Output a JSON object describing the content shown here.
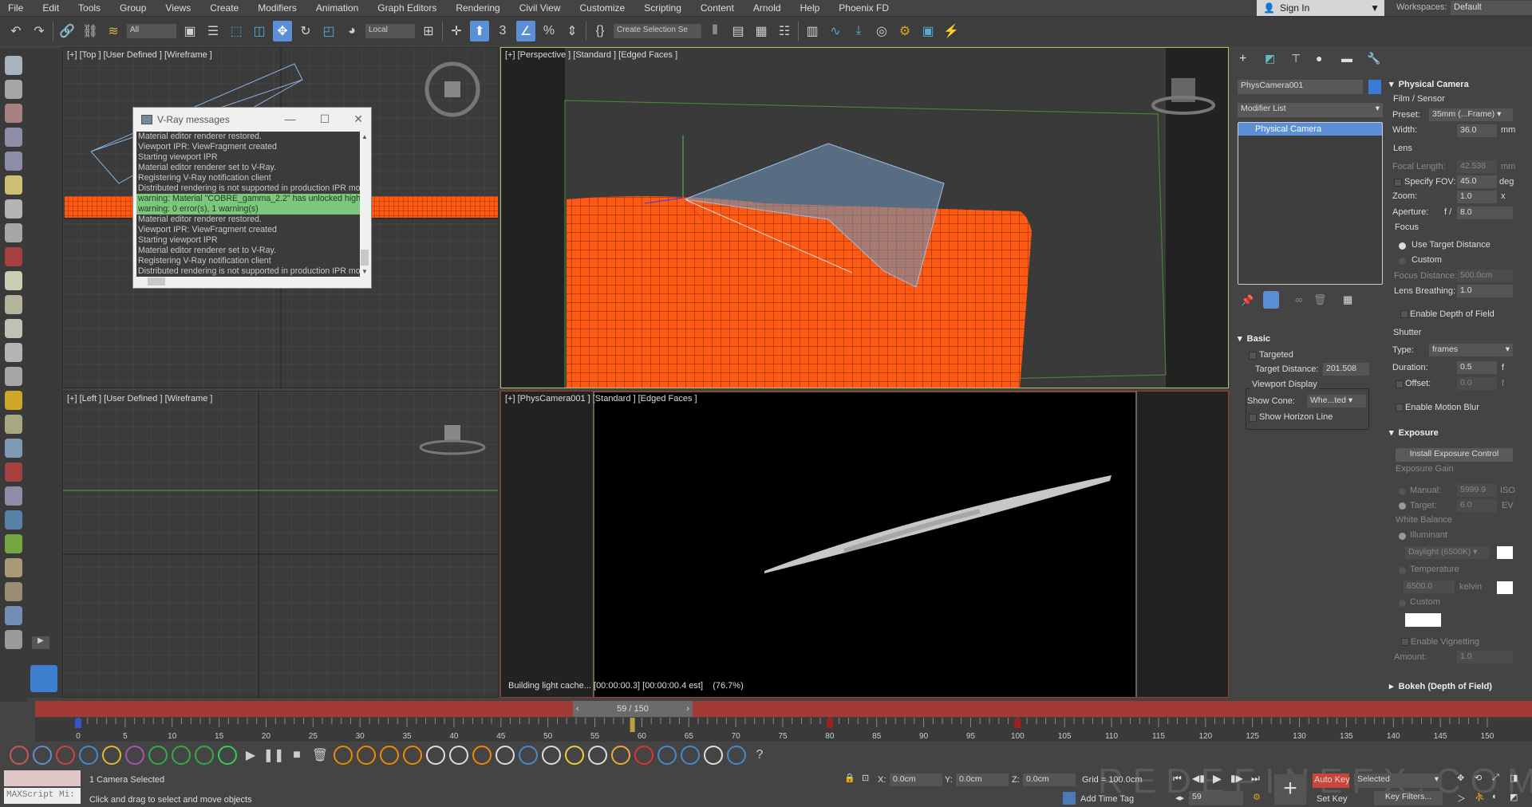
{
  "menu": [
    "File",
    "Edit",
    "Tools",
    "Group",
    "Views",
    "Create",
    "Modifiers",
    "Animation",
    "Graph Editors",
    "Rendering",
    "Civil View",
    "Customize",
    "Scripting",
    "Content",
    "Arnold",
    "Help",
    "Phoenix FD"
  ],
  "signin": "Sign In",
  "workspaces": {
    "label": "Workspaces:",
    "value": "Default"
  },
  "toolbar": {
    "selection_filter": "All",
    "ref_coord": "Local",
    "named_selection": "Create Selection Se"
  },
  "viewports": {
    "top": "[+] [Top ] [User Defined ] [Wireframe ]",
    "perspective": "[+] [Perspective ] [Standard ] [Edged Faces ]",
    "left": "[+] [Left ] [User Defined ] [Wireframe ]",
    "camera": "[+] [PhysCamera001 ] [Standard ] [Edged Faces ]",
    "render_status": "Building light cache... [00:00:00.3] [00:00:00.4 est]    (76.7%)"
  },
  "vray_dialog": {
    "title": "V-Ray messages",
    "lines": [
      {
        "t": "Material editor renderer restored.",
        "w": false
      },
      {
        "t": "Viewport IPR: ViewFragment created",
        "w": false
      },
      {
        "t": "Starting viewport IPR",
        "w": false
      },
      {
        "t": "Material editor renderer set to V-Ray.",
        "w": false
      },
      {
        "t": "Registering V-Ray notification client",
        "w": false
      },
      {
        "t": "Distributed rendering is not supported in production IPR mod",
        "w": false
      },
      {
        "t": "warning: Material \"COBRE_gamma_2.2\" has unlocked highl",
        "w": true
      },
      {
        "t": "warning: 0 error(s), 1 warning(s)",
        "w": true
      },
      {
        "t": "Material editor renderer restored.",
        "w": false
      },
      {
        "t": "Viewport IPR: ViewFragment created",
        "w": false
      },
      {
        "t": "Starting viewport IPR",
        "w": false
      },
      {
        "t": "Material editor renderer set to V-Ray.",
        "w": false
      },
      {
        "t": "Registering V-Ray notification client",
        "w": false
      },
      {
        "t": "Distributed rendering is not supported in production IPR mod",
        "w": false
      }
    ]
  },
  "panel": {
    "object_name": "PhysCamera001",
    "object_color": "#3a7bd5",
    "modifier_list": "Modifier List",
    "stack": [
      "Physical Camera"
    ],
    "basic": {
      "header": "Basic",
      "targeted": "Targeted",
      "target_distance_label": "Target Distance:",
      "target_distance": "201.508",
      "viewport_display": "Viewport Display",
      "show_cone_label": "Show Cone:",
      "show_cone": "Whe...ted",
      "show_horizon": "Show Horizon Line"
    },
    "physcam": {
      "header": "Physical Camera",
      "film": "Film / Sensor",
      "preset_label": "Preset:",
      "preset": "35mm (...Frame)",
      "width_label": "Width:",
      "width": "36.0",
      "mm": "mm",
      "lens": "Lens",
      "focal_label": "Focal Length:",
      "focal": "42.538",
      "fov_label": "Specify FOV:",
      "fov": "45.0",
      "deg": "deg",
      "zoom_label": "Zoom:",
      "zoom": "1.0",
      "x": "x",
      "aperture_label": "Aperture:",
      "f": "f /",
      "aperture": "8.0",
      "focus": "Focus",
      "use_target": "Use Target Distance",
      "custom": "Custom",
      "focus_dist_label": "Focus Distance:",
      "focus_dist": "500.0cm",
      "breathing_label": "Lens Breathing:",
      "breathing": "1.0",
      "dof": "Enable Depth of Field",
      "shutter": "Shutter",
      "type_label": "Type:",
      "type": "frames",
      "duration_label": "Duration:",
      "duration": "0.5",
      "fu": "f",
      "offset_label": "Offset:",
      "offset": "0.0",
      "motion_blur": "Enable Motion Blur"
    },
    "exposure": {
      "header": "Exposure",
      "install": "Install Exposure Control",
      "gain": "Exposure Gain",
      "manual_label": "Manual:",
      "manual": "5999.9",
      "iso": "ISO",
      "target_label": "Target:",
      "target": "6.0",
      "ev": "EV",
      "wb": "White Balance",
      "illuminant": "Illuminant",
      "daylight": "Daylight (6500K)",
      "temperature": "Temperature",
      "temp_val": "6500.0",
      "kelvin": "kelvin",
      "custom": "Custom",
      "vignetting": "Enable Vignetting",
      "amount_label": "Amount:",
      "amount": "1.0"
    },
    "bokeh": "Bokeh (Depth of Field)"
  },
  "timeline": {
    "current": 59,
    "end": 150,
    "frame_display": "59 / 150",
    "start": 0,
    "label_step": 5,
    "keys": [
      0,
      80,
      100
    ]
  },
  "bottom_icons": [
    "box",
    "box-wire",
    "fire-red",
    "drop-blue",
    "bubbles",
    "sphere-purple",
    "gear-green",
    "arrow-green",
    "grid-green",
    "burst-green",
    "play",
    "pause",
    "stop",
    "trash",
    "fire",
    "fire",
    "fire",
    "fire",
    "smoke",
    "smoke",
    "candle",
    "cup",
    "drop",
    "milk",
    "beer",
    "coffee",
    "pour",
    "flame-red",
    "ocean",
    "wave",
    "waterfall",
    "sea",
    "help"
  ],
  "status": {
    "maxscript": "MAXScript Mi:",
    "selected": "1 Camera Selected",
    "prompt": "Click and drag to select and move objects",
    "x_label": "X:",
    "x": "0.0cm",
    "y_label": "Y:",
    "y": "0.0cm",
    "z_label": "Z:",
    "z": "0.0cm",
    "grid": "Grid = 100.0cm",
    "add_time_tag": "Add Time Tag",
    "frame": "59",
    "auto_key": "Auto Key",
    "key_mode": "Selected",
    "set_key": "Set Key",
    "key_filters": "Key Filters...",
    "watermark": "REDEFINEFX.COM"
  },
  "colors": {
    "accent": "#5b8fd6",
    "timeline": "#a03a32",
    "warning": "#7cc77c",
    "wire": "#ff5a14"
  }
}
